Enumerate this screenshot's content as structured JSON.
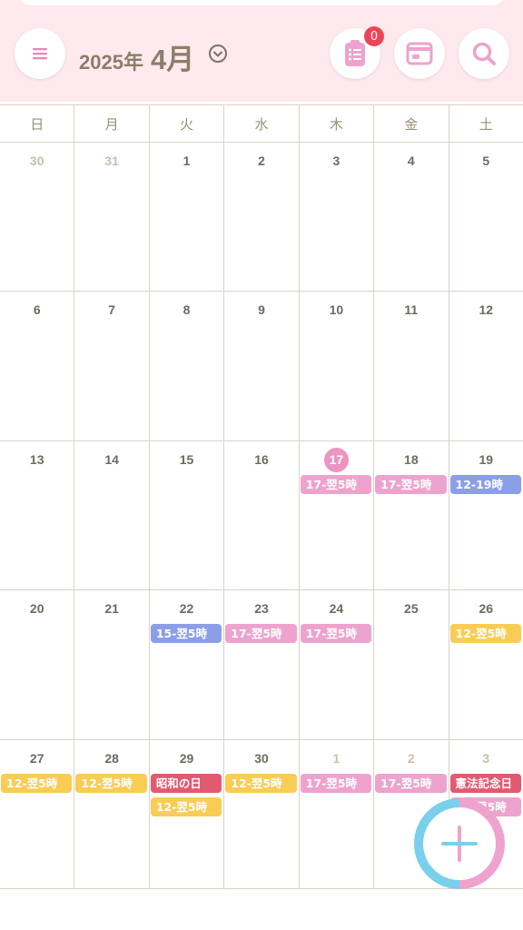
{
  "header": {
    "year_label": "2025年",
    "month_label": "4月",
    "badge_count": "0",
    "icons": [
      "menu-icon",
      "list-icon",
      "calendar-icon",
      "search-icon",
      "chevron-down-icon",
      "plus-icon"
    ]
  },
  "weekdays": [
    "日",
    "月",
    "火",
    "水",
    "木",
    "金",
    "土"
  ],
  "colors": {
    "pink": "#eda3cd",
    "blue": "#8b9ee8",
    "yellow": "#f9cc55",
    "red": "#e25a70",
    "header_bg": "#fde9ee",
    "today": "#ec94c2"
  },
  "weeks": [
    [
      {
        "day": "30",
        "out": true,
        "events": []
      },
      {
        "day": "31",
        "out": true,
        "events": []
      },
      {
        "day": "1",
        "events": []
      },
      {
        "day": "2",
        "events": []
      },
      {
        "day": "3",
        "events": []
      },
      {
        "day": "4",
        "events": []
      },
      {
        "day": "5",
        "events": []
      }
    ],
    [
      {
        "day": "6",
        "events": []
      },
      {
        "day": "7",
        "events": []
      },
      {
        "day": "8",
        "events": []
      },
      {
        "day": "9",
        "events": []
      },
      {
        "day": "10",
        "events": []
      },
      {
        "day": "11",
        "events": []
      },
      {
        "day": "12",
        "events": []
      }
    ],
    [
      {
        "day": "13",
        "events": []
      },
      {
        "day": "14",
        "events": []
      },
      {
        "day": "15",
        "events": []
      },
      {
        "day": "16",
        "events": []
      },
      {
        "day": "17",
        "today": true,
        "events": [
          {
            "label": "17-翌5時",
            "color": "pink"
          }
        ]
      },
      {
        "day": "18",
        "events": [
          {
            "label": "17-翌5時",
            "color": "pink"
          }
        ]
      },
      {
        "day": "19",
        "events": [
          {
            "label": "12-19時",
            "color": "blue"
          }
        ]
      }
    ],
    [
      {
        "day": "20",
        "events": []
      },
      {
        "day": "21",
        "events": []
      },
      {
        "day": "22",
        "events": [
          {
            "label": "15-翌5時",
            "color": "blue"
          }
        ]
      },
      {
        "day": "23",
        "events": [
          {
            "label": "17-翌5時",
            "color": "pink"
          }
        ]
      },
      {
        "day": "24",
        "events": [
          {
            "label": "17-翌5時",
            "color": "pink"
          }
        ]
      },
      {
        "day": "25",
        "events": []
      },
      {
        "day": "26",
        "events": [
          {
            "label": "12-翌5時",
            "color": "yellow"
          }
        ]
      }
    ],
    [
      {
        "day": "27",
        "events": [
          {
            "label": "12-翌5時",
            "color": "yellow"
          }
        ]
      },
      {
        "day": "28",
        "events": [
          {
            "label": "12-翌5時",
            "color": "yellow"
          }
        ]
      },
      {
        "day": "29",
        "events": [
          {
            "label": "昭和の日",
            "color": "red"
          },
          {
            "label": "12-翌5時",
            "color": "yellow"
          }
        ]
      },
      {
        "day": "30",
        "events": [
          {
            "label": "12-翌5時",
            "color": "yellow"
          }
        ]
      },
      {
        "day": "1",
        "out": true,
        "events": [
          {
            "label": "17-翌5時",
            "color": "pink"
          }
        ]
      },
      {
        "day": "2",
        "out": true,
        "events": [
          {
            "label": "17-翌5時",
            "color": "pink"
          }
        ]
      },
      {
        "day": "3",
        "out": true,
        "events": [
          {
            "label": "憲法記念日",
            "color": "red"
          },
          {
            "label": "17-翌5時",
            "color": "pink"
          }
        ]
      }
    ]
  ]
}
